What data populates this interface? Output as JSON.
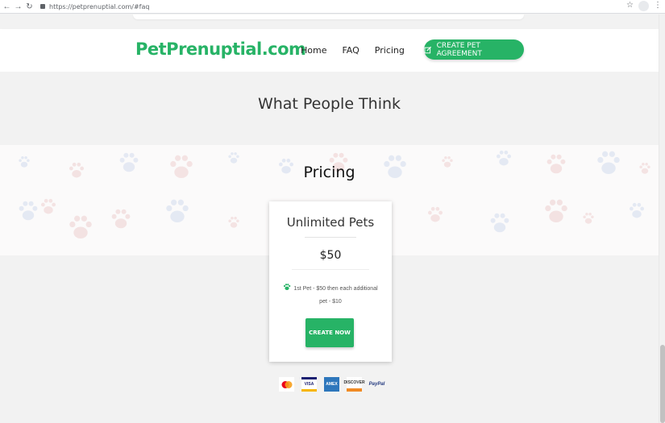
{
  "browser": {
    "url": "https://petprenuptial.com/#faq"
  },
  "header": {
    "logo": "PetPrenuptial.com",
    "nav": [
      "Home",
      "FAQ",
      "Pricing"
    ],
    "cta_label": "CREATE PET AGREEMENT"
  },
  "sections": {
    "testimonials_title": "What People Think",
    "pricing_title": "Pricing"
  },
  "pricing_card": {
    "plan_name": "Unlimited Pets",
    "price": "$50",
    "feature": "1st Pet - $50 then each additional pet - $10",
    "button_label": "CREATE NOW"
  },
  "payment_methods": [
    "mastercard-icon",
    "visa-icon",
    "amex-icon",
    "discover-icon",
    "paypal-icon"
  ],
  "payment_labels": {
    "visa": "VISA",
    "amex": "AMEX",
    "discover": "DISCOVER",
    "paypal": "PayPal"
  },
  "colors": {
    "brand_green": "#27b366",
    "background": "#f2f2f2"
  }
}
